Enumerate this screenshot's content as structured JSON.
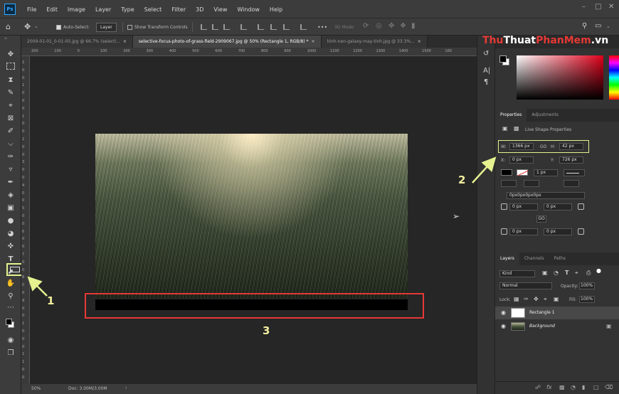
{
  "app": {
    "logo": "Ps",
    "menu": [
      "File",
      "Edit",
      "Image",
      "Layer",
      "Type",
      "Select",
      "Filter",
      "3D",
      "View",
      "Window",
      "Help"
    ]
  },
  "options_bar": {
    "auto_select_label": "Auto-Select:",
    "auto_select_value": "Layer",
    "show_transform": "Show Transform Controls",
    "more": "•••",
    "mode_3d": "3D Mode:"
  },
  "tabs": [
    {
      "label": "2009-01-01_0-01-05.jpg @ 66.7% (selecti...",
      "active": false
    },
    {
      "label": "selective-focus-photo-of-grass-field-2909067.jpg @ 50% (Rectangle 1, RGB/8) *",
      "active": true
    },
    {
      "label": "hinh-nen-galaxy-may-tinh.jpg @ 33.3%...",
      "active": false
    }
  ],
  "ruler_top_ticks": [
    "200",
    "100",
    "0",
    "100",
    "200",
    "300",
    "400",
    "500",
    "600",
    "700",
    "800",
    "900",
    "1000",
    "1100",
    "1200",
    "1300",
    "1400",
    "1500",
    "160"
  ],
  "ruler_left_ticks": [
    "2",
    "0",
    "0",
    "1",
    "0",
    "0",
    "0",
    "1",
    "0",
    "0",
    "2",
    "0",
    "0",
    "3",
    "0",
    "0",
    "4",
    "0",
    "0",
    "5",
    "0",
    "0",
    "6",
    "0",
    "0",
    "7",
    "0",
    "0",
    "8",
    "0",
    "0",
    "9",
    "0",
    "0",
    "1",
    "0",
    "0",
    "0",
    "1",
    "1",
    "0",
    "0"
  ],
  "status": {
    "zoom": "50%",
    "doc": "Doc: 3.00M/3.00M"
  },
  "properties": {
    "tabs": [
      "Properties",
      "Adjustments"
    ],
    "title": "Live Shape Properties",
    "w_label": "W:",
    "w_value": "1366 px",
    "link": "GO",
    "h_label": "H:",
    "h_value": "42 px",
    "x_label": "X:",
    "x_value": "0 px",
    "y_label": "Y:",
    "y_value": "726 px",
    "stroke_size": "1 px",
    "radius_text": "0px0px0px0px",
    "corner_tl": "0 px",
    "corner_tr": "0 px",
    "corner_bl": "0 px",
    "corner_br": "0 px",
    "corner_link": "GO"
  },
  "layers": {
    "tabs": [
      "Layers",
      "Channels",
      "Paths"
    ],
    "kind": "Kind",
    "blend": "Normal",
    "opacity_label": "Opacity:",
    "opacity_value": "100%",
    "lock_label": "Lock:",
    "fill_label": "Fill:",
    "fill_value": "100%",
    "items": [
      {
        "name": "Rectangle 1",
        "selected": true
      },
      {
        "name": "Background",
        "selected": false
      }
    ]
  },
  "annotations": {
    "one": "1",
    "two": "2",
    "three": "3"
  },
  "watermark": {
    "part1": "Thu",
    "part2": "Thuat",
    "part3": "PhanMem",
    "part4": ".vn"
  },
  "colors": {
    "accent": "#31a8ff",
    "highlight_red": "#e53935",
    "annotation_yellow": "#f3ef9e"
  }
}
